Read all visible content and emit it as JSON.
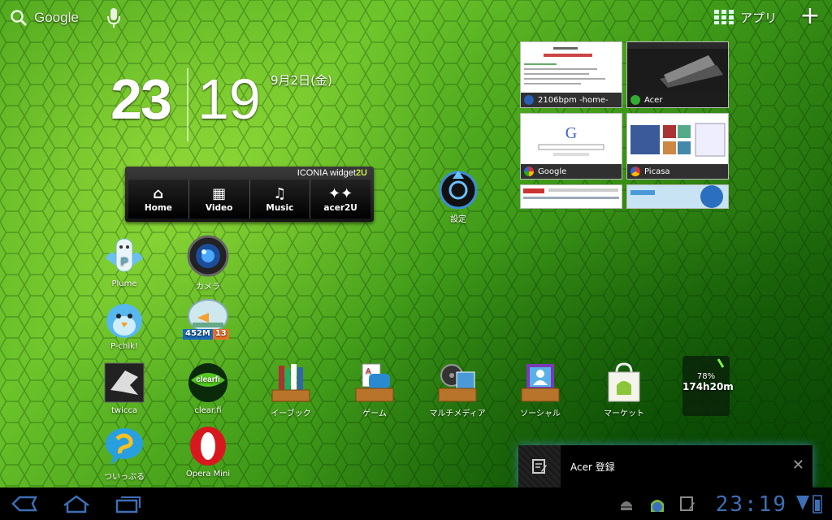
{
  "top_bar": {
    "search_label": "Google",
    "apps_label": "アプリ"
  },
  "clock": {
    "hour": "23",
    "minute": "19",
    "date": "9月2日(金)"
  },
  "iconia_widget": {
    "brand_prefix": "ICONIA widget",
    "brand_suffix": "2U",
    "buttons": [
      {
        "label": "Home",
        "icon": "home-icon"
      },
      {
        "label": "Video",
        "icon": "film-icon"
      },
      {
        "label": "Music",
        "icon": "music-note-icon"
      },
      {
        "label": "acer2U",
        "icon": "stars-icon"
      }
    ]
  },
  "settings_label": "設定",
  "browser_thumbnails": [
    {
      "title": "2106bpm -home-"
    },
    {
      "title": "Acer"
    },
    {
      "title": "Google"
    },
    {
      "title": "Picasa"
    }
  ],
  "icons": [
    {
      "label": "Plume"
    },
    {
      "label": "カメラ"
    },
    {
      "label": "P-chik!"
    },
    {
      "label": "",
      "badge_left": "452M",
      "badge_right": "13"
    },
    {
      "label": "twicca"
    },
    {
      "label": "clear.fi"
    },
    {
      "label": "イーブック"
    },
    {
      "label": "ゲーム"
    },
    {
      "label": "マルチメディア"
    },
    {
      "label": "ソーシャル"
    },
    {
      "label": "マーケット"
    },
    {
      "label": "ついっぷる"
    },
    {
      "label": "Opera Mini"
    }
  ],
  "clearfi_logo_text": "clearfi",
  "battery_widget": {
    "percent": "78%",
    "time": "174h20m"
  },
  "notification": {
    "text": "Acer 登録"
  },
  "system_bar": {
    "clock": "23:19"
  },
  "colors": {
    "wallpaper_green": "#4aa51c",
    "system_clock_blue": "#3c6fb5"
  }
}
